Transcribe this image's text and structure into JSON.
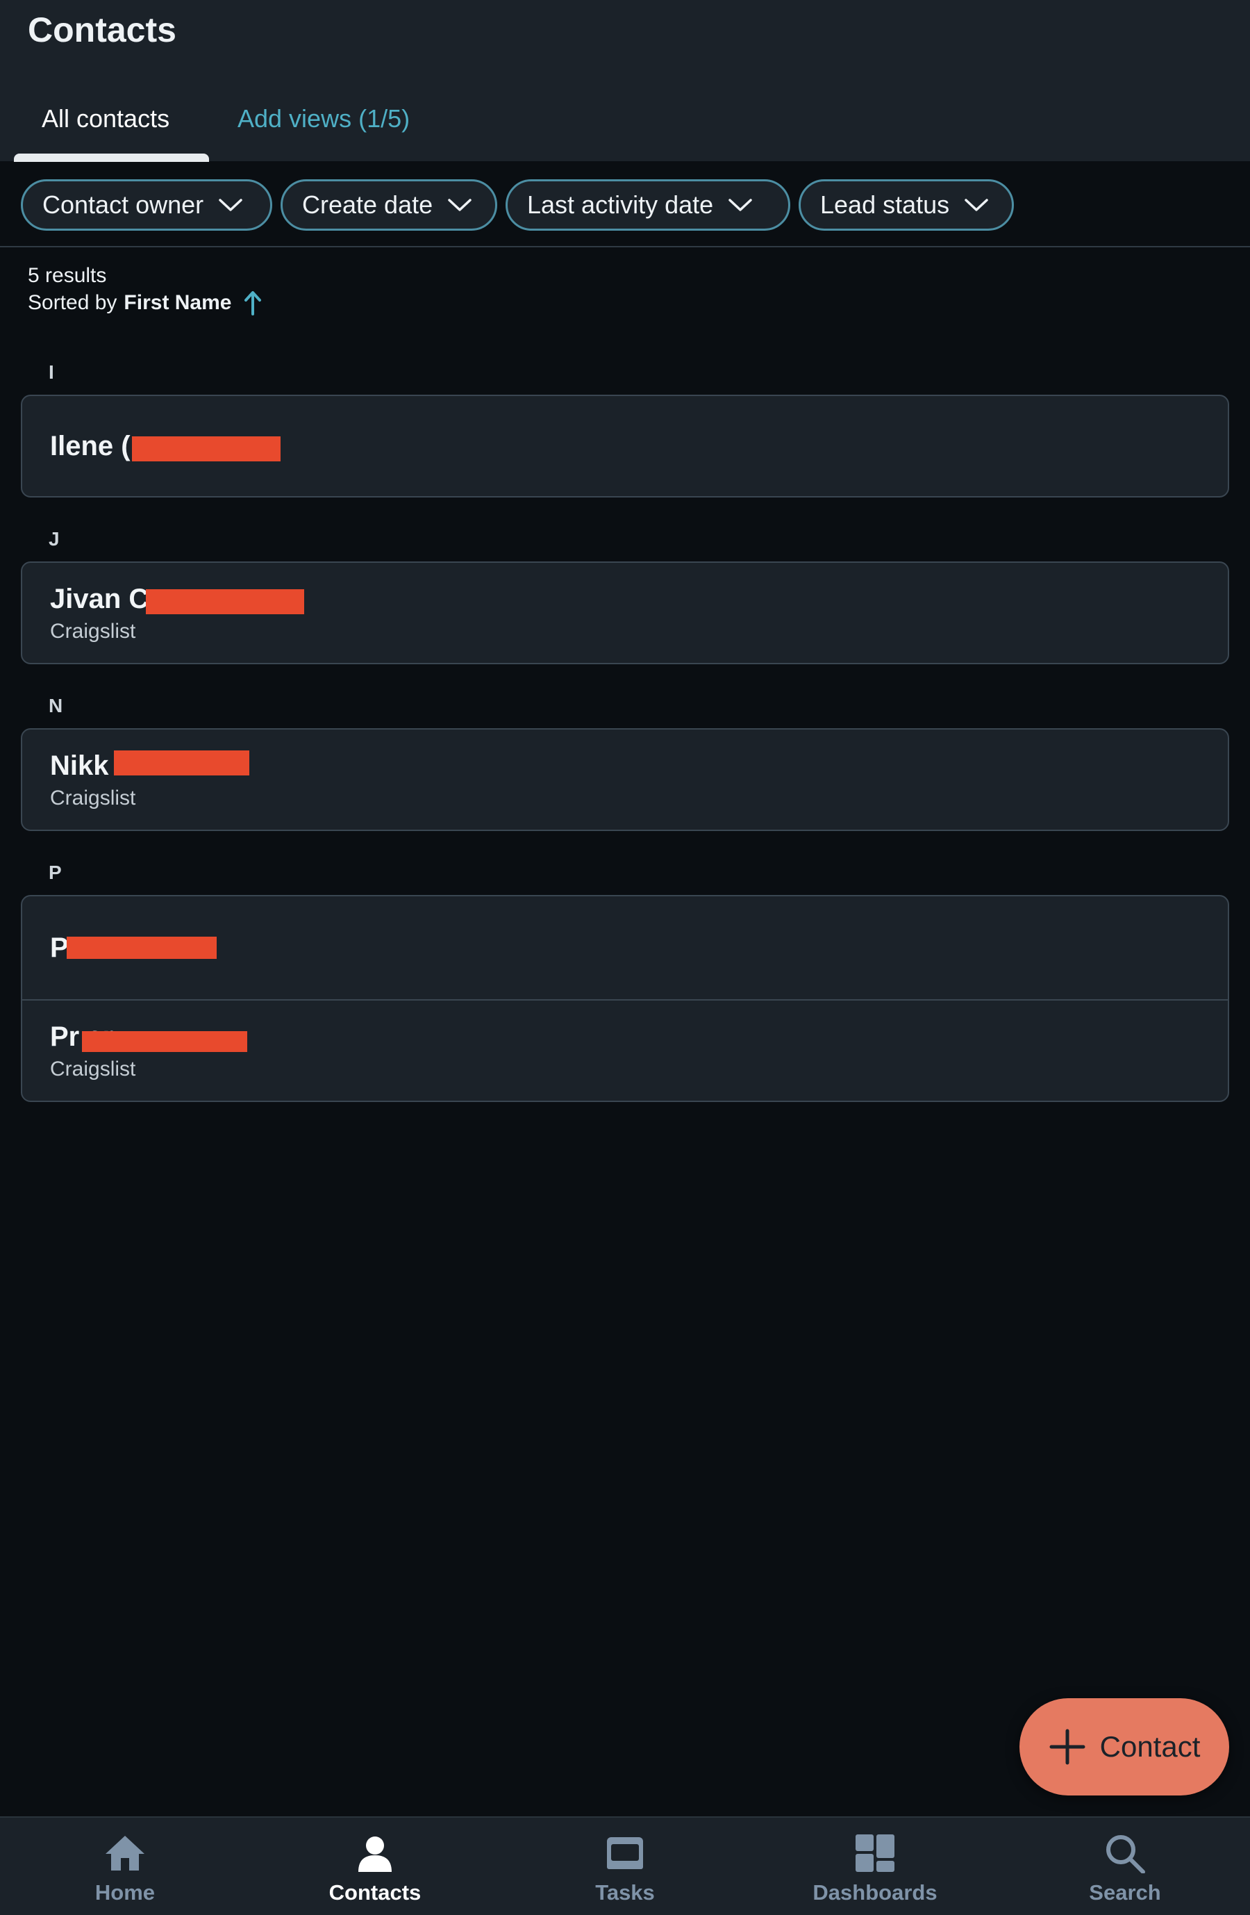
{
  "header": {
    "title": "Contacts",
    "tabs": [
      {
        "label": "All contacts",
        "active": true
      },
      {
        "label": "Add views (1/5)",
        "active": false
      }
    ]
  },
  "filters": [
    {
      "label": "Contact owner"
    },
    {
      "label": "Create date"
    },
    {
      "label": "Last activity date"
    },
    {
      "label": "Lead status"
    }
  ],
  "results": {
    "count_text": "5 results",
    "sorted_prefix": "Sorted by",
    "sorted_field": "First Name",
    "sort_direction": "ascending"
  },
  "groups": [
    {
      "letter": "I",
      "contacts": [
        {
          "name": "Ilene (",
          "subtitle": ""
        }
      ]
    },
    {
      "letter": "J",
      "contacts": [
        {
          "name": "Jivan C",
          "subtitle": "Craigslist"
        }
      ]
    },
    {
      "letter": "N",
      "contacts": [
        {
          "name": "Nikk          d",
          "subtitle": "Craigslist"
        }
      ]
    },
    {
      "letter": "P",
      "contacts": [
        {
          "name": "P",
          "subtitle": ""
        },
        {
          "name": "Pr                   er",
          "subtitle": "Craigslist"
        }
      ]
    }
  ],
  "fab": {
    "label": "Contact"
  },
  "bottom_nav": [
    {
      "label": "Home",
      "icon": "home-icon",
      "active": false
    },
    {
      "label": "Contacts",
      "icon": "person-icon",
      "active": true
    },
    {
      "label": "Tasks",
      "icon": "tasks-icon",
      "active": false
    },
    {
      "label": "Dashboards",
      "icon": "dashboard-icon",
      "active": false
    },
    {
      "label": "Search",
      "icon": "search-icon",
      "active": false
    }
  ],
  "colors": {
    "accent": "#4fb0c6",
    "fab": "#e57a61",
    "redaction": "#e84a2d",
    "surface": "#1b2229",
    "background": "#0a0e12"
  }
}
